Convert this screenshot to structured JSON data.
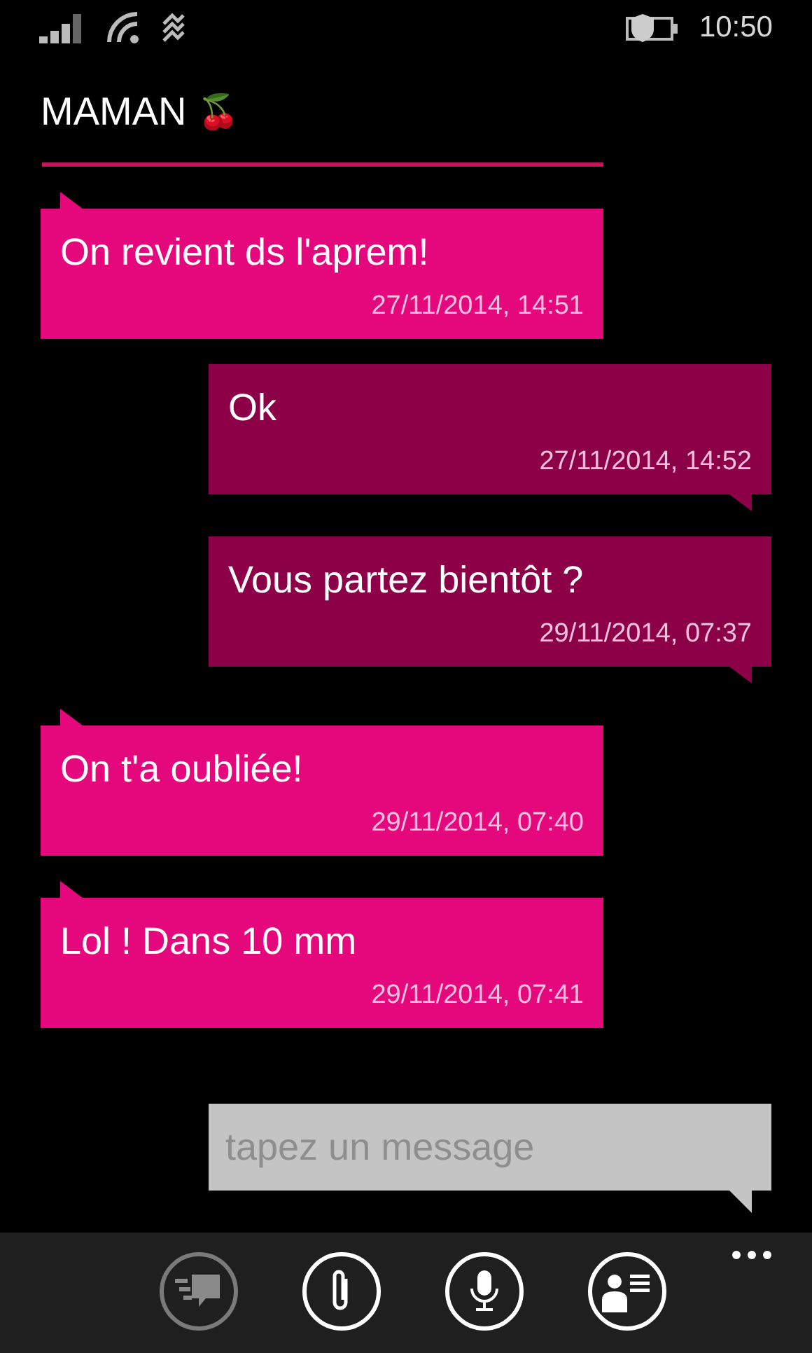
{
  "status_bar": {
    "time": "10:50"
  },
  "title": {
    "text": "MAMAN",
    "emoji": "🍒"
  },
  "messages": [
    {
      "kind": "received",
      "text": "On revient ds l'aprem!",
      "time": "27/11/2014, 14:51"
    },
    {
      "kind": "sent",
      "text": "Ok",
      "time": "27/11/2014, 14:52"
    },
    {
      "kind": "sent",
      "text": "Vous partez bientôt ?",
      "time": "29/11/2014, 07:37"
    },
    {
      "kind": "received",
      "text": "On t'a oubliée!",
      "time": "29/11/2014, 07:40"
    },
    {
      "kind": "received",
      "text": "Lol ! Dans 10 mm",
      "time": "29/11/2014, 07:41"
    }
  ],
  "composer": {
    "placeholder": "tapez un message"
  },
  "app_bar": {
    "buttons": [
      {
        "kind": "send",
        "disabled": true
      },
      {
        "kind": "attach",
        "disabled": false
      },
      {
        "kind": "voice",
        "disabled": false
      },
      {
        "kind": "contact",
        "disabled": false
      }
    ]
  }
}
